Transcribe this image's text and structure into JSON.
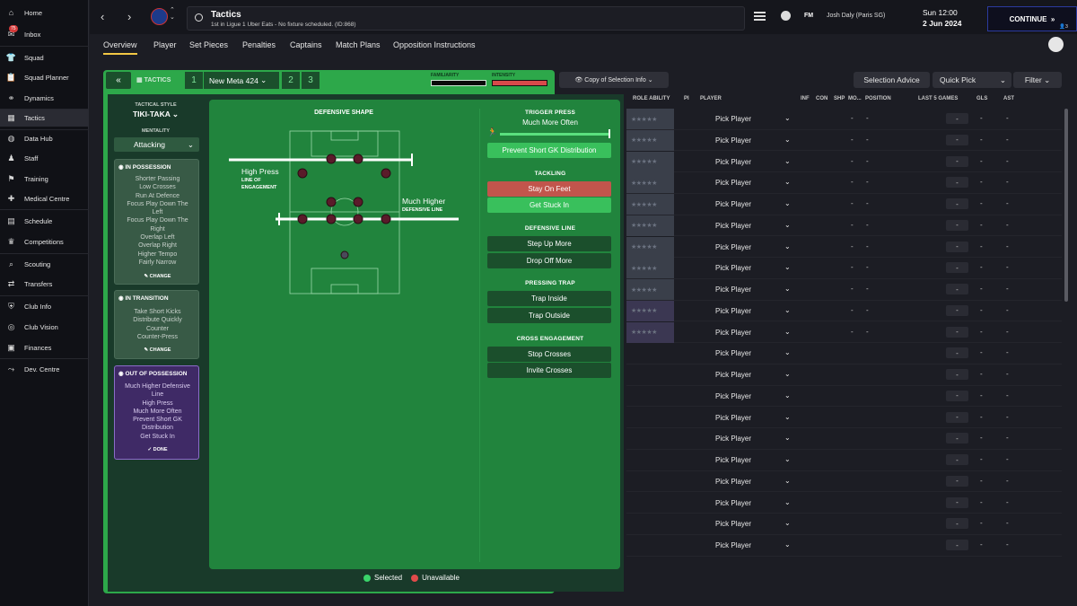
{
  "sidebar": {
    "items": [
      {
        "label": "Home",
        "icon": "home-icon"
      },
      {
        "label": "Inbox",
        "icon": "inbox-icon",
        "badge": "75"
      },
      {
        "label": "Squad",
        "icon": "shirt-icon"
      },
      {
        "label": "Squad Planner",
        "icon": "clipboard-icon"
      },
      {
        "label": "Dynamics",
        "icon": "dynamics-icon"
      },
      {
        "label": "Tactics",
        "icon": "tactics-icon"
      },
      {
        "label": "Data Hub",
        "icon": "data-hub-icon"
      },
      {
        "label": "Staff",
        "icon": "staff-icon"
      },
      {
        "label": "Training",
        "icon": "training-icon"
      },
      {
        "label": "Medical Centre",
        "icon": "medical-icon"
      },
      {
        "label": "Schedule",
        "icon": "calendar-icon"
      },
      {
        "label": "Competitions",
        "icon": "trophy-icon"
      },
      {
        "label": "Scouting",
        "icon": "scouting-icon"
      },
      {
        "label": "Transfers",
        "icon": "transfers-icon"
      },
      {
        "label": "Club Info",
        "icon": "shield-icon"
      },
      {
        "label": "Club Vision",
        "icon": "vision-icon"
      },
      {
        "label": "Finances",
        "icon": "finances-icon"
      },
      {
        "label": "Dev. Centre",
        "icon": "dev-centre-icon"
      }
    ]
  },
  "header": {
    "title": "Tactics",
    "subtitle": "1st in Ligue 1 Uber Eats - No fixture scheduled. (ID:868)",
    "fm": "FM",
    "manager": "Josh Daly (Paris SG)",
    "day_time": "Sun 12:00",
    "date": "2 Jun 2024",
    "continue": "CONTINUE",
    "notif_count": "3"
  },
  "subnav": [
    "Overview",
    "Player",
    "Set Pieces",
    "Penalties",
    "Captains",
    "Match Plans",
    "Opposition Instructions"
  ],
  "tactics": {
    "label": "TACTICS",
    "slot1": "1",
    "name": "New Meta 424",
    "slot2": "2",
    "slot3": "3",
    "familiarity": "FAMILIARITY",
    "intensity": "INTENSITY",
    "style_label": "TACTICAL STYLE",
    "style": "TIKI-TAKA",
    "mentality_label": "MENTALITY",
    "mentality": "Attacking"
  },
  "in_possession": {
    "title": "IN POSSESSION",
    "lines": [
      "Shorter Passing",
      "Low Crosses",
      "Run At Defence",
      "Focus Play Down The",
      "Left",
      "Focus Play Down The",
      "Right",
      "Overlap Left",
      "Overlap Right",
      "Higher Tempo",
      "Fairly Narrow"
    ],
    "action": "CHANGE"
  },
  "in_transition": {
    "title": "IN TRANSITION",
    "lines": [
      "Take Short Kicks",
      "Distribute Quickly",
      "Counter",
      "Counter-Press"
    ],
    "action": "CHANGE"
  },
  "out_of_possession": {
    "title": "OUT OF POSSESSION",
    "lines": [
      "Much Higher Defensive",
      "Line",
      "High Press",
      "Much More Often",
      "Prevent Short GK",
      "Distribution",
      "Get Stuck In"
    ],
    "action": "DONE"
  },
  "pitch": {
    "title": "DEFENSIVE SHAPE",
    "loe_value": "High Press",
    "loe_label1": "LINE OF",
    "loe_label2": "ENGAGEMENT",
    "dl_value": "Much Higher",
    "dl_label": "DEFENSIVE LINE"
  },
  "instructions": {
    "trigger_title": "TRIGGER PRESS",
    "trigger_value": "Much More Often",
    "prevent": "Prevent Short GK Distribution",
    "tackling_title": "TACKLING",
    "tackling": [
      "Stay On Feet",
      "Get Stuck In"
    ],
    "defline_title": "DEFENSIVE LINE",
    "defline": [
      "Step Up More",
      "Drop Off More"
    ],
    "trap_title": "PRESSING TRAP",
    "trap": [
      "Trap Inside",
      "Trap Outside"
    ],
    "cross_title": "CROSS ENGAGEMENT",
    "cross": [
      "Stop Crosses",
      "Invite Crosses"
    ]
  },
  "legend": {
    "selected": "Selected",
    "unavailable": "Unavailable"
  },
  "right": {
    "copy_selection": "Copy of Selection Info",
    "selection_advice": "Selection Advice",
    "quick_pick": "Quick Pick",
    "filter": "Filter",
    "headers": [
      "ROLE ABILITY",
      "PI",
      "PLAYER",
      "INF",
      "CON",
      "SHP",
      "MO...",
      "POSITION",
      "LAST 5 GAMES",
      "GLS",
      "AST"
    ],
    "rows": 21,
    "pick_label": "Pick Player",
    "dash": "-",
    "stars": "★★★★★"
  },
  "colors": {
    "accent_green": "#2da84a",
    "dark_green": "#193a2a",
    "selected": "#3ad46a",
    "unavailable": "#e24b4b",
    "purple": "#3f2a66"
  }
}
